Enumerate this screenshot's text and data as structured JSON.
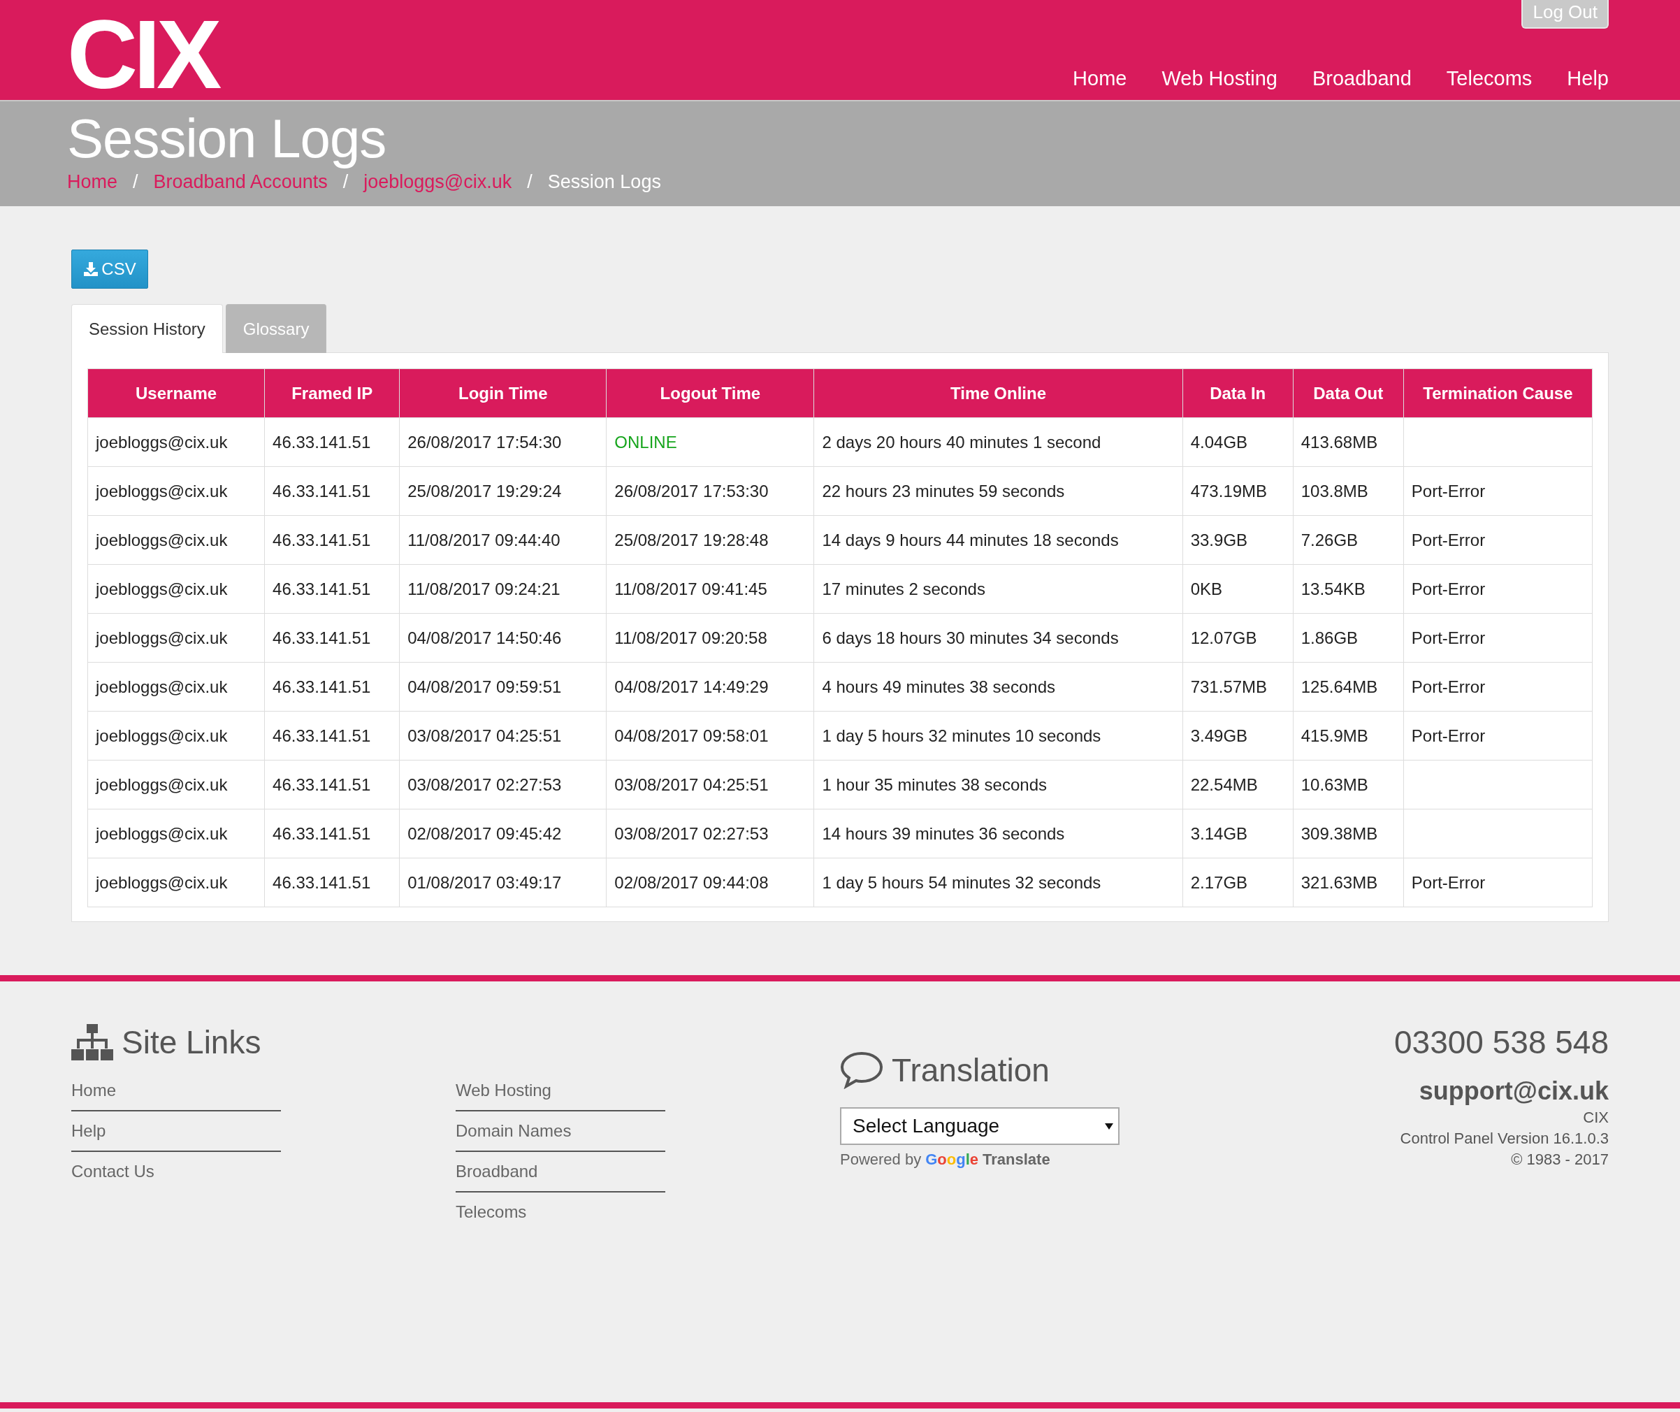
{
  "header": {
    "logo": "CIX",
    "logout": "Log Out",
    "nav": [
      {
        "label": "Home"
      },
      {
        "label": "Web Hosting"
      },
      {
        "label": "Broadband"
      },
      {
        "label": "Telecoms"
      },
      {
        "label": "Help"
      }
    ]
  },
  "banner": {
    "title": "Session Logs",
    "breadcrumb": [
      {
        "label": "Home",
        "link": true
      },
      {
        "label": "Broadband Accounts",
        "link": true,
        "separator": "/"
      },
      {
        "label": "joebloggs@cix.uk",
        "link": true,
        "separator": "/"
      },
      {
        "label": "Session Logs",
        "link": false,
        "separator": "/"
      }
    ]
  },
  "csv_button": "CSV",
  "tabs": [
    {
      "label": "Session History",
      "selected": true
    },
    {
      "label": "Glossary",
      "selected": false
    }
  ],
  "table": {
    "columns": [
      "Username",
      "Framed IP",
      "Login Time",
      "Logout Time",
      "Time Online",
      "Data In",
      "Data Out",
      "Termination Cause"
    ],
    "rows": [
      {
        "online": true,
        "cells": [
          "joebloggs@cix.uk",
          "46.33.141.51",
          "26/08/2017 17:54:30",
          "ONLINE",
          "2 days 20 hours 40 minutes 1 second",
          "4.04GB",
          "413.68MB",
          ""
        ]
      },
      {
        "online": false,
        "cells": [
          "joebloggs@cix.uk",
          "46.33.141.51",
          "25/08/2017 19:29:24",
          "26/08/2017 17:53:30",
          "22 hours 23 minutes 59 seconds",
          "473.19MB",
          "103.8MB",
          "Port-Error"
        ]
      },
      {
        "online": false,
        "cells": [
          "joebloggs@cix.uk",
          "46.33.141.51",
          "11/08/2017 09:44:40",
          "25/08/2017 19:28:48",
          "14 days 9 hours 44 minutes 18 seconds",
          "33.9GB",
          "7.26GB",
          "Port-Error"
        ]
      },
      {
        "online": false,
        "cells": [
          "joebloggs@cix.uk",
          "46.33.141.51",
          "11/08/2017 09:24:21",
          "11/08/2017 09:41:45",
          "17 minutes 2 seconds",
          "0KB",
          "13.54KB",
          "Port-Error"
        ]
      },
      {
        "online": false,
        "cells": [
          "joebloggs@cix.uk",
          "46.33.141.51",
          "04/08/2017 14:50:46",
          "11/08/2017 09:20:58",
          "6 days 18 hours 30 minutes 34 seconds",
          "12.07GB",
          "1.86GB",
          "Port-Error"
        ]
      },
      {
        "online": false,
        "cells": [
          "joebloggs@cix.uk",
          "46.33.141.51",
          "04/08/2017 09:59:51",
          "04/08/2017 14:49:29",
          "4 hours 49 minutes 38 seconds",
          "731.57MB",
          "125.64MB",
          "Port-Error"
        ]
      },
      {
        "online": false,
        "cells": [
          "joebloggs@cix.uk",
          "46.33.141.51",
          "03/08/2017 04:25:51",
          "04/08/2017 09:58:01",
          "1 day 5 hours 32 minutes 10 seconds",
          "3.49GB",
          "415.9MB",
          "Port-Error"
        ]
      },
      {
        "online": false,
        "cells": [
          "joebloggs@cix.uk",
          "46.33.141.51",
          "03/08/2017 02:27:53",
          "03/08/2017 04:25:51",
          "1 hour 35 minutes 38 seconds",
          "22.54MB",
          "10.63MB",
          ""
        ]
      },
      {
        "online": false,
        "cells": [
          "joebloggs@cix.uk",
          "46.33.141.51",
          "02/08/2017 09:45:42",
          "03/08/2017 02:27:53",
          "14 hours 39 minutes 36 seconds",
          "3.14GB",
          "309.38MB",
          ""
        ]
      },
      {
        "online": false,
        "cells": [
          "joebloggs@cix.uk",
          "46.33.141.51",
          "01/08/2017 03:49:17",
          "02/08/2017 09:44:08",
          "1 day 5 hours 54 minutes 32 seconds",
          "2.17GB",
          "321.63MB",
          "Port-Error"
        ]
      }
    ]
  },
  "footer": {
    "site_links": {
      "title": "Site Links",
      "columns": [
        [
          "Home",
          "Help",
          "Contact Us"
        ],
        [
          "Web Hosting",
          "Domain Names",
          "Broadband",
          "Telecoms"
        ]
      ]
    },
    "translation": {
      "title": "Translation",
      "select": "Select Language",
      "powered_by": "Powered by",
      "google": "Google",
      "translate": "Translate"
    },
    "contact": {
      "phone": "03300 538 548",
      "email": "support@cix.uk",
      "company": "CIX",
      "version": "Control Panel Version 16.1.0.3",
      "copyright": "© 1983 - 2017"
    }
  }
}
